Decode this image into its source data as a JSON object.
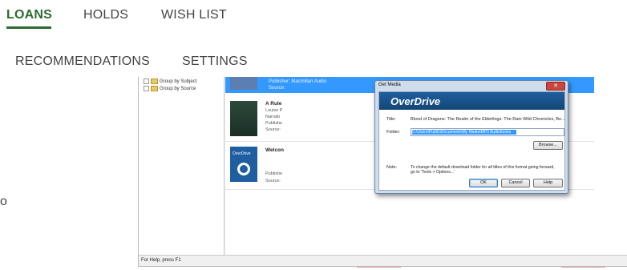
{
  "tabs_primary": [
    {
      "label": "LOANS",
      "active": true
    },
    {
      "label": "HOLDS",
      "active": false
    },
    {
      "label": "WISH LIST",
      "active": false
    }
  ],
  "tabs_secondary": [
    {
      "label": "RECOMMENDATIONS"
    },
    {
      "label": "SETTINGS"
    }
  ],
  "accent_color": "#2b6b2f",
  "stray_char": "o",
  "app": {
    "tree": [
      "Group by Subject",
      "Group by Source"
    ],
    "selected_row": {
      "line1": "Publisher:   Macmillan Audio",
      "line2": "Source:"
    },
    "book1": {
      "title": "A Rule",
      "lines": [
        "Louise P",
        "Narrato",
        "Publishe",
        "Source:"
      ]
    },
    "book2": {
      "title": "Welcon",
      "logo": "OverDrive",
      "lines": [
        "Publishe",
        "Source:"
      ]
    },
    "status": "For Help, press F1"
  },
  "dialog": {
    "window_title": "Get Media",
    "banner": "OverDrive",
    "title_label": "Title:",
    "title_value": "Blood of Dragons: The Realm of the Elderlings: The Rain Wild Chronicles, Bo...",
    "folder_label": "Folder:",
    "folder_value": "C:\\Users\\Public\\Documents\\My Media\\MP3 Audiobooks",
    "browse_label": "Browse...",
    "note_label": "Note:",
    "note_text": "To change the default download folder for all titles of this format going forward, go to 'Tools > Options...'",
    "ok_label": "OK",
    "cancel_label": "Cancel",
    "help_label": "Help",
    "close_glyph": "✕"
  }
}
